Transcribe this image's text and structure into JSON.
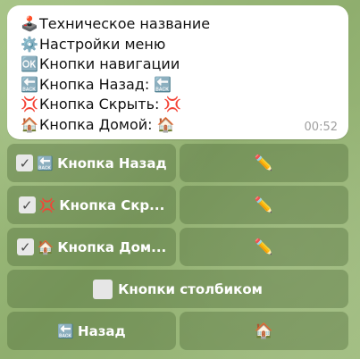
{
  "message": {
    "lines": [
      {
        "icon": "🕹️",
        "text": "Техническое название",
        "tail": ""
      },
      {
        "icon": "⚙️",
        "text": "Настройки меню",
        "tail": ""
      },
      {
        "icon": "🆗",
        "text": "Кнопки навигации",
        "tail": ""
      },
      {
        "icon": "🔙",
        "text": "Кнопка Назад:",
        "tail": "🔙"
      },
      {
        "icon": "💢",
        "text": "Кнопка Скрыть:",
        "tail": "💢"
      },
      {
        "icon": "🏠",
        "text": "Кнопка Домой:",
        "tail": "🏠"
      }
    ],
    "time": "00:52"
  },
  "keyboard": {
    "rows": [
      {
        "left": {
          "check": "✓",
          "icon": "🔙",
          "label": "Кнопка Назад"
        },
        "right": {
          "icon": "✏️"
        }
      },
      {
        "left": {
          "check": "✓",
          "icon": "💢",
          "label": "Кнопка Скр..."
        },
        "right": {
          "icon": "✏️"
        }
      },
      {
        "left": {
          "check": "✓",
          "icon": "🏠",
          "label": "Кнопка Дом..."
        },
        "right": {
          "icon": "✏️"
        }
      }
    ],
    "columns_button": {
      "label": "Кнопки столбиком"
    },
    "back_button": {
      "icon": "🔙",
      "label": "Назад"
    },
    "home_button": {
      "icon": "🏠"
    }
  }
}
